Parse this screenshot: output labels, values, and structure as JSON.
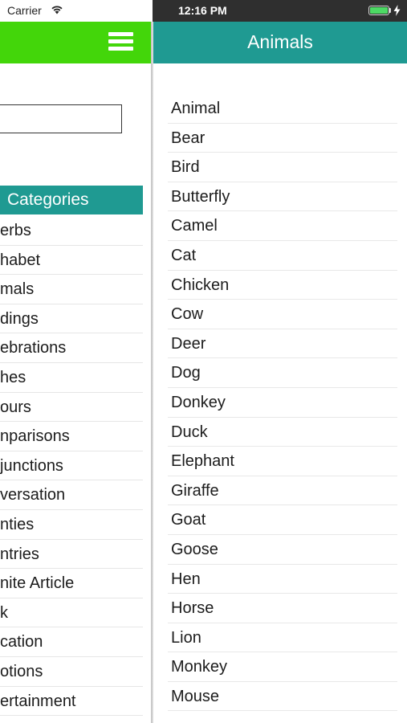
{
  "status_bar": {
    "carrier": "Carrier",
    "time": "12:16 PM",
    "battery_level": 1.0,
    "battery_color": "#4cd964"
  },
  "menu": {
    "header_color": "#43d60a",
    "menu_icon": "hamburger-menu-icon",
    "search": {
      "value": "",
      "placeholder": ""
    },
    "categories_title": "Categories",
    "categories": [
      "erbs",
      "habet",
      "mals",
      "dings",
      "ebrations",
      "hes",
      "ours",
      "nparisons",
      "junctions",
      "versation",
      "nties",
      "ntries",
      "nite Article",
      "k",
      "cation",
      "otions",
      "ertainment"
    ]
  },
  "content": {
    "header_color": "#1f9a92",
    "title": "Animals",
    "animals": [
      "Animal",
      "Bear",
      "Bird",
      "Butterfly",
      "Camel",
      "Cat",
      "Chicken",
      "Cow",
      "Deer",
      "Dog",
      "Donkey",
      "Duck",
      "Elephant",
      "Giraffe",
      "Goat",
      "Goose",
      "Hen",
      "Horse",
      "Lion",
      "Monkey",
      "Mouse"
    ]
  }
}
